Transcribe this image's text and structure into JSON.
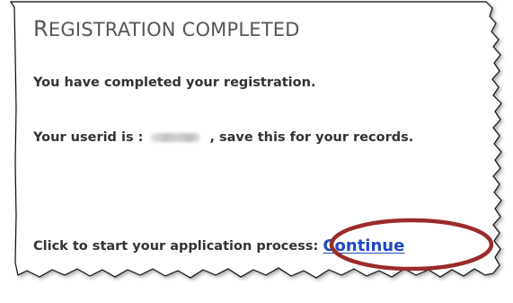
{
  "page": {
    "heading": "Registration completed",
    "heading_first_letter": "R",
    "heading_rest": "EGISTRATION COMPLETED"
  },
  "messages": {
    "completed": "You have completed your registration.",
    "userid_prefix": "Your userid is :",
    "userid_value_redacted": true,
    "userid_suffix": ",  save this for your records.",
    "continue_prompt": "Click to start your application process:",
    "continue_label": "Continue"
  },
  "annotations": {
    "continue_highlight": "red ellipse around the Continue link"
  },
  "colors": {
    "heading": "#555555",
    "body_text": "#333333",
    "link": "#1f48c4",
    "highlight_ellipse": "#9b2b2b",
    "frame_border": "#111111"
  }
}
